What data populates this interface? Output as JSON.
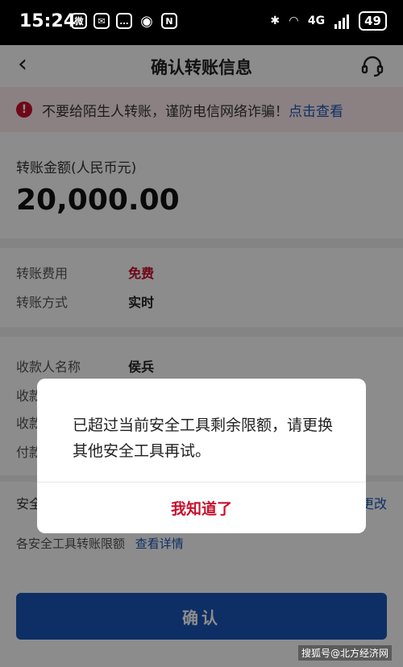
{
  "status_bar": {
    "time": "15:24",
    "battery": "49",
    "network": "4G",
    "apps": [
      {
        "icon": "weibo-icon",
        "glyph": "微"
      },
      {
        "icon": "wechat-icon",
        "glyph": "✉"
      },
      {
        "icon": "message-icon",
        "glyph": "…"
      },
      {
        "icon": "eye-icon",
        "glyph": "◉"
      },
      {
        "icon": "nfc-icon",
        "glyph": "N"
      }
    ]
  },
  "nav": {
    "title": "确认转账信息",
    "back_icon": "‹"
  },
  "warning": {
    "text": "不要给陌生人转账，谨防电信网络诈骗！",
    "link": "点击查看"
  },
  "amount": {
    "label": "转账金额(人民币元)",
    "value": "20,000.00"
  },
  "details": [
    {
      "key": "转账费用",
      "value": "免费"
    },
    {
      "key": "转账方式",
      "value": "实时"
    }
  ],
  "recipient": {
    "name_label": "收款人名称",
    "name_value": "侯兵",
    "row2_label": "收款",
    "row3_label": "收款",
    "row4_label": "付款"
  },
  "safety": {
    "label": "安全",
    "change": "更改",
    "limit_label": "各安全工具转账限额",
    "limit_link": "查看详情"
  },
  "confirm_button": "确认",
  "watermark": "搜狐号@北方经济网",
  "dialog": {
    "message": "已超过当前安全工具剩余限额，请更换其他安全工具再试。",
    "button": "我知道了"
  },
  "colors": {
    "accent": "#1a56b8",
    "danger": "#c8102e"
  }
}
